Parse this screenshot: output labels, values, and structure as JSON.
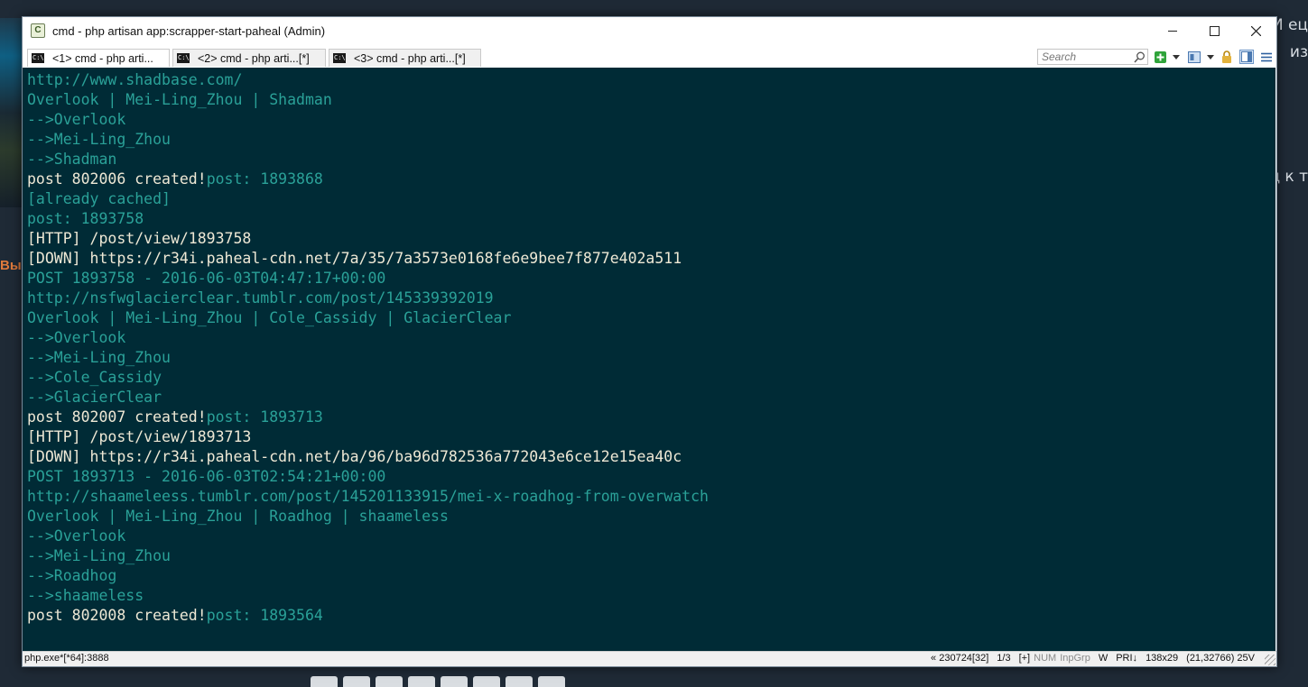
{
  "background": {
    "right_snippets": [
      "И ец",
      "из",
      "ц к т"
    ],
    "left_word": "Вые"
  },
  "window": {
    "title": "cmd - php  artisan app:scrapper-start-paheal (Admin)",
    "app_icon": "conemu-icon",
    "controls": {
      "minimize": "—",
      "maximize": "☐",
      "close": "✕"
    }
  },
  "tabs": [
    {
      "label": "<1> cmd - php  arti...",
      "active": true
    },
    {
      "label": "<2> cmd - php  arti...[*]",
      "active": false
    },
    {
      "label": "<3> cmd - php  arti...[*]",
      "active": false
    }
  ],
  "toolbar": {
    "search_placeholder": "Search",
    "icons": [
      "search-icon",
      "new-console-icon",
      "dropdown-icon",
      "window-layout-icon",
      "dropdown-icon",
      "lock-icon",
      "split-view-icon",
      "menu-icon"
    ]
  },
  "console": {
    "colors": {
      "background": "#002b36",
      "dim": "#2aa198",
      "bright": "#eee8d5"
    },
    "lines": [
      {
        "segments": [
          {
            "t": "http://www.shadbase.com/",
            "c": "dim"
          }
        ]
      },
      {
        "segments": [
          {
            "t": "Overlook | Mei-Ling_Zhou | Shadman",
            "c": "dim"
          }
        ]
      },
      {
        "segments": [
          {
            "t": "-->Overlook",
            "c": "dim"
          }
        ]
      },
      {
        "segments": [
          {
            "t": "-->Mei-Ling_Zhou",
            "c": "dim"
          }
        ]
      },
      {
        "segments": [
          {
            "t": "-->Shadman",
            "c": "dim"
          }
        ]
      },
      {
        "segments": [
          {
            "t": "post 802006 created!",
            "c": "bright"
          },
          {
            "t": "post: 1893868",
            "c": "dim"
          }
        ]
      },
      {
        "segments": [
          {
            "t": "[already cached]",
            "c": "dim"
          }
        ]
      },
      {
        "segments": [
          {
            "t": "post: 1893758",
            "c": "dim"
          }
        ]
      },
      {
        "segments": [
          {
            "t": "[HTTP] /post/view/1893758",
            "c": "bright"
          }
        ]
      },
      {
        "segments": [
          {
            "t": "[DOWN] https://r34i.paheal-cdn.net/7a/35/7a3573e0168fe6e9bee7f877e402a511",
            "c": "bright"
          }
        ]
      },
      {
        "segments": [
          {
            "t": "POST 1893758 - 2016-06-03T04:47:17+00:00",
            "c": "dim"
          }
        ]
      },
      {
        "segments": [
          {
            "t": "http://nsfwglacierclear.tumblr.com/post/145339392019",
            "c": "dim"
          }
        ]
      },
      {
        "segments": [
          {
            "t": "Overlook | Mei-Ling_Zhou | Cole_Cassidy | GlacierClear",
            "c": "dim"
          }
        ]
      },
      {
        "segments": [
          {
            "t": "-->Overlook",
            "c": "dim"
          }
        ]
      },
      {
        "segments": [
          {
            "t": "-->Mei-Ling_Zhou",
            "c": "dim"
          }
        ]
      },
      {
        "segments": [
          {
            "t": "-->Cole_Cassidy",
            "c": "dim"
          }
        ]
      },
      {
        "segments": [
          {
            "t": "-->GlacierClear",
            "c": "dim"
          }
        ]
      },
      {
        "segments": [
          {
            "t": "post 802007 created!",
            "c": "bright"
          },
          {
            "t": "post: 1893713",
            "c": "dim"
          }
        ]
      },
      {
        "segments": [
          {
            "t": "[HTTP] /post/view/1893713",
            "c": "bright"
          }
        ]
      },
      {
        "segments": [
          {
            "t": "[DOWN] https://r34i.paheal-cdn.net/ba/96/ba96d782536a772043e6ce12e15ea40c",
            "c": "bright"
          }
        ]
      },
      {
        "segments": [
          {
            "t": "POST 1893713 - 2016-06-03T02:54:21+00:00",
            "c": "dim"
          }
        ]
      },
      {
        "segments": [
          {
            "t": "http://shaameleess.tumblr.com/post/145201133915/mei-x-roadhog-from-overwatch",
            "c": "dim"
          }
        ]
      },
      {
        "segments": [
          {
            "t": "Overlook | Mei-Ling_Zhou | Roadhog | shaameless",
            "c": "dim"
          }
        ]
      },
      {
        "segments": [
          {
            "t": "-->Overlook",
            "c": "dim"
          }
        ]
      },
      {
        "segments": [
          {
            "t": "-->Mei-Ling_Zhou",
            "c": "dim"
          }
        ]
      },
      {
        "segments": [
          {
            "t": "-->Roadhog",
            "c": "dim"
          }
        ]
      },
      {
        "segments": [
          {
            "t": "-->shaameless",
            "c": "dim"
          }
        ]
      },
      {
        "segments": [
          {
            "t": "post 802008 created!",
            "c": "bright"
          },
          {
            "t": "post: 1893564",
            "c": "dim"
          }
        ]
      }
    ]
  },
  "statusbar": {
    "process": "php.exe*[*64]:3888",
    "position": "« 230724[32]",
    "console_index": "1/3",
    "plus": "[+]",
    "num": "NUM",
    "inpgrp": "InpGrp",
    "w": "W",
    "pri": "PRI↓",
    "size": "138x29",
    "cursor": "(21,32766) 25V"
  }
}
